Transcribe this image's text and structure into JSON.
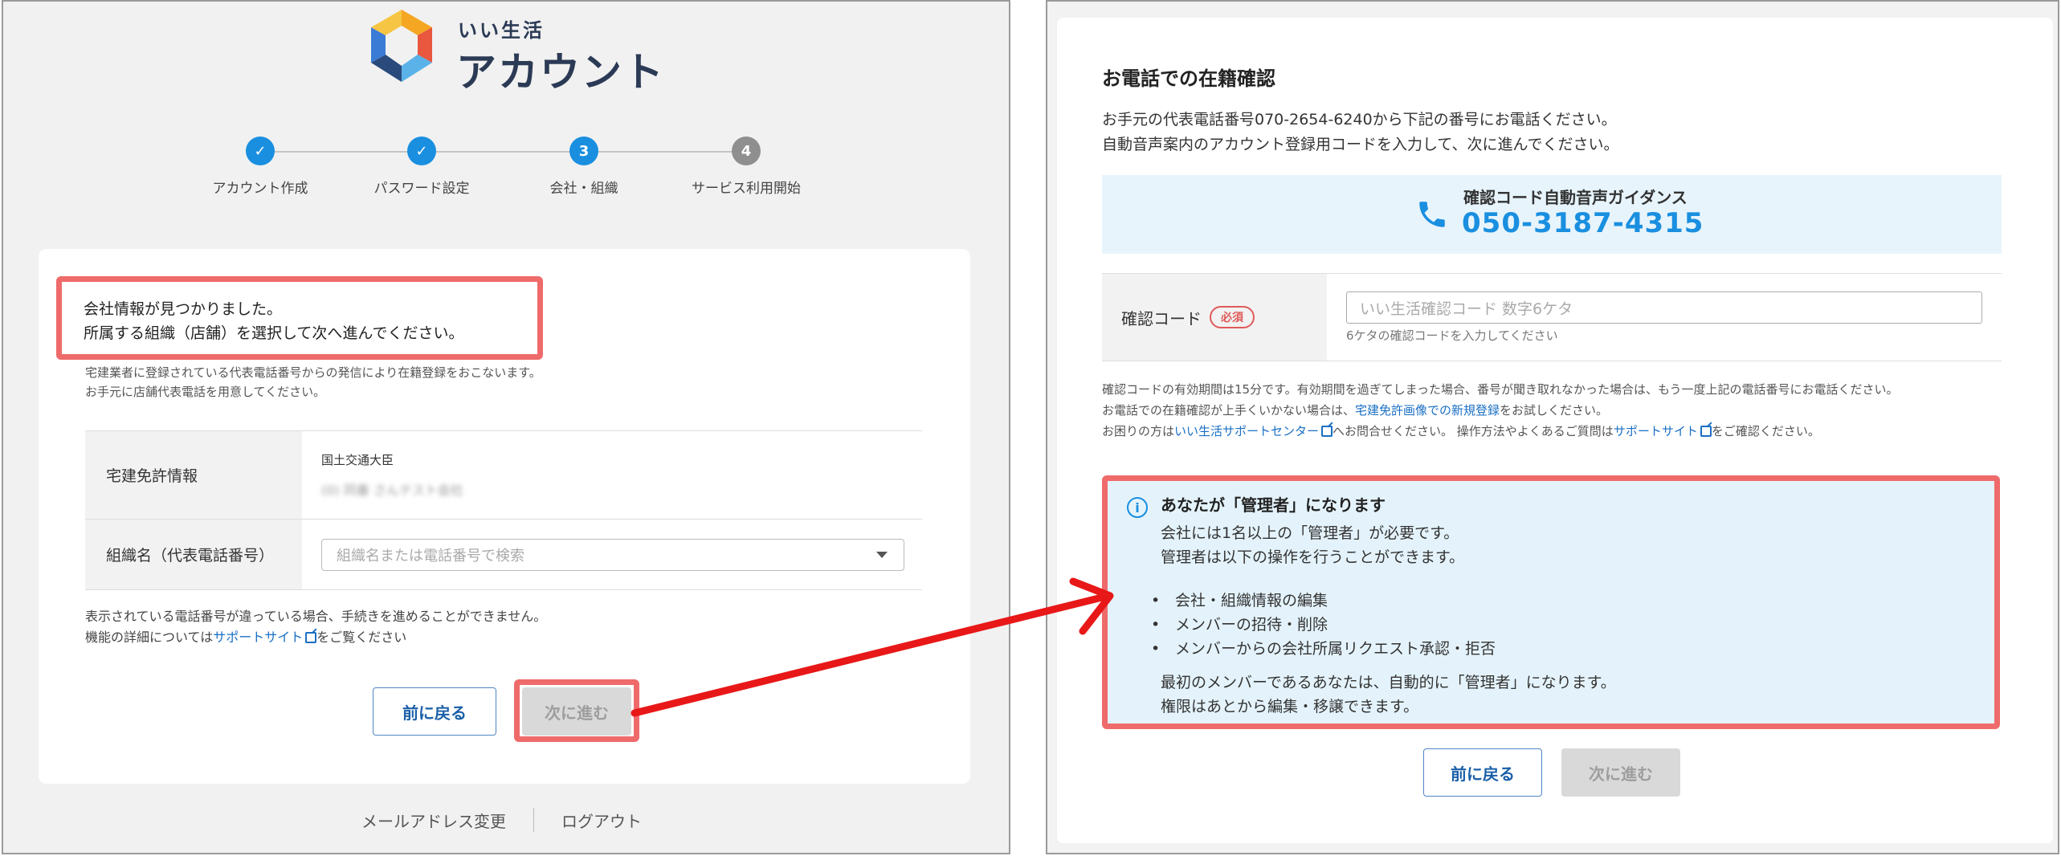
{
  "left": {
    "logo": {
      "sub": "いい生活",
      "main": "アカウント"
    },
    "steps": [
      {
        "label": "アカウント作成",
        "mark": "✓",
        "state": "done"
      },
      {
        "label": "パスワード設定",
        "mark": "✓",
        "state": "done"
      },
      {
        "label": "会社・組織",
        "mark": "3",
        "state": "current"
      },
      {
        "label": "サービス利用開始",
        "mark": "4",
        "state": "todo"
      }
    ],
    "found_line1": "会社情報が見つかりました。",
    "found_line2": "所属する組織（店舗）を選択して次へ進んでください。",
    "note_line1": "宅建業者に登録されている代表電話番号からの発信により在籍登録をおこないます。",
    "note_line2": "お手元に店舗代表電話を用意してください。",
    "license_label": "宅建免許情報",
    "license_authority": "国土交通大臣",
    "license_blurred": "(0) 同番 さんテスト会社",
    "org_label": "組織名（代表電話番号）",
    "org_placeholder": "組織名または電話番号で検索",
    "warn_line1": "表示されている電話番号が違っている場合、手続きを進めることができません。",
    "warn_pre": "機能の詳細については",
    "warn_link": "サポートサイト",
    "warn_post": "をご覧ください",
    "back": "前に戻る",
    "next": "次に進む",
    "footer_email": "メールアドレス変更",
    "footer_logout": "ログアウト"
  },
  "right": {
    "title": "お電話での在籍確認",
    "desc_line1": "お手元の代表電話番号070-2654-6240から下記の番号にお電話ください。",
    "desc_line2": "自動音声案内のアカウント登録用コードを入力して、次に進んでください。",
    "guide_label": "確認コード自動音声ガイダンス",
    "guide_phone": "050-3187-4315",
    "code_label": "確認コード",
    "required_badge": "必須",
    "code_placeholder": "いい生活確認コード 数字6ケタ",
    "code_hint": "6ケタの確認コードを入力してください",
    "note_line1": "確認コードの有効期間は15分です。有効期間を過ぎてしまった場合、番号が聞き取れなかった場合は、もう一度上記の電話番号にお電話ください。",
    "note2_pre": "お電話での在籍確認が上手くいかない場合は、",
    "note2_link": "宅建免許画像での新規登録",
    "note2_post": "をお試しください。",
    "note3_pre": "お困りの方は",
    "note3_link1": "いい生活サポートセンター",
    "note3_mid": "へお問合せください。 操作方法やよくあるご質問は",
    "note3_link2": "サポートサイト",
    "note3_post": "をご確認ください。",
    "admin_title": "あなたが「管理者」になります",
    "admin_p1_line1": "会社には1名以上の「管理者」が必要です。",
    "admin_p1_line2": "管理者は以下の操作を行うことができます。",
    "admin_items": [
      "会社・組織情報の編集",
      "メンバーの招待・削除",
      "メンバーからの会社所属リクエスト承認・拒否"
    ],
    "admin_p2_line1": "最初のメンバーであるあなたは、自動的に「管理者」になります。",
    "admin_p2_line2": "権限はあとから編集・移譲できます。",
    "back": "前に戻る",
    "next": "次に進む"
  },
  "colors": {
    "accent": "#1a8fe0",
    "highlight": "#ef6a6a",
    "arrow": "#e81818",
    "link": "#1a6fc4"
  }
}
